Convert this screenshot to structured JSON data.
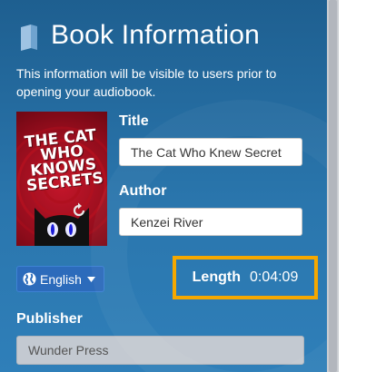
{
  "header": {
    "icon": "book-icon",
    "title": "Book Information",
    "description": "This information will be visible to users prior to opening your audiobook."
  },
  "cover": {
    "title_art": "THE CAT WHO KNOWS SECRETS",
    "icons": [
      "cat-icon",
      "reload-icon"
    ]
  },
  "fields": {
    "title_label": "Title",
    "title_value": "The Cat Who Knew Secret",
    "author_label": "Author",
    "author_value": "Kenzei River",
    "publisher_label": "Publisher",
    "publisher_value": "Wunder Press"
  },
  "language": {
    "icon": "globe-icon",
    "selected": "English"
  },
  "length": {
    "label": "Length",
    "value": "0:04:09"
  },
  "colors": {
    "panel": "#2a76ad",
    "highlight": "#f5a800",
    "language_button": "#2c6bbb"
  }
}
